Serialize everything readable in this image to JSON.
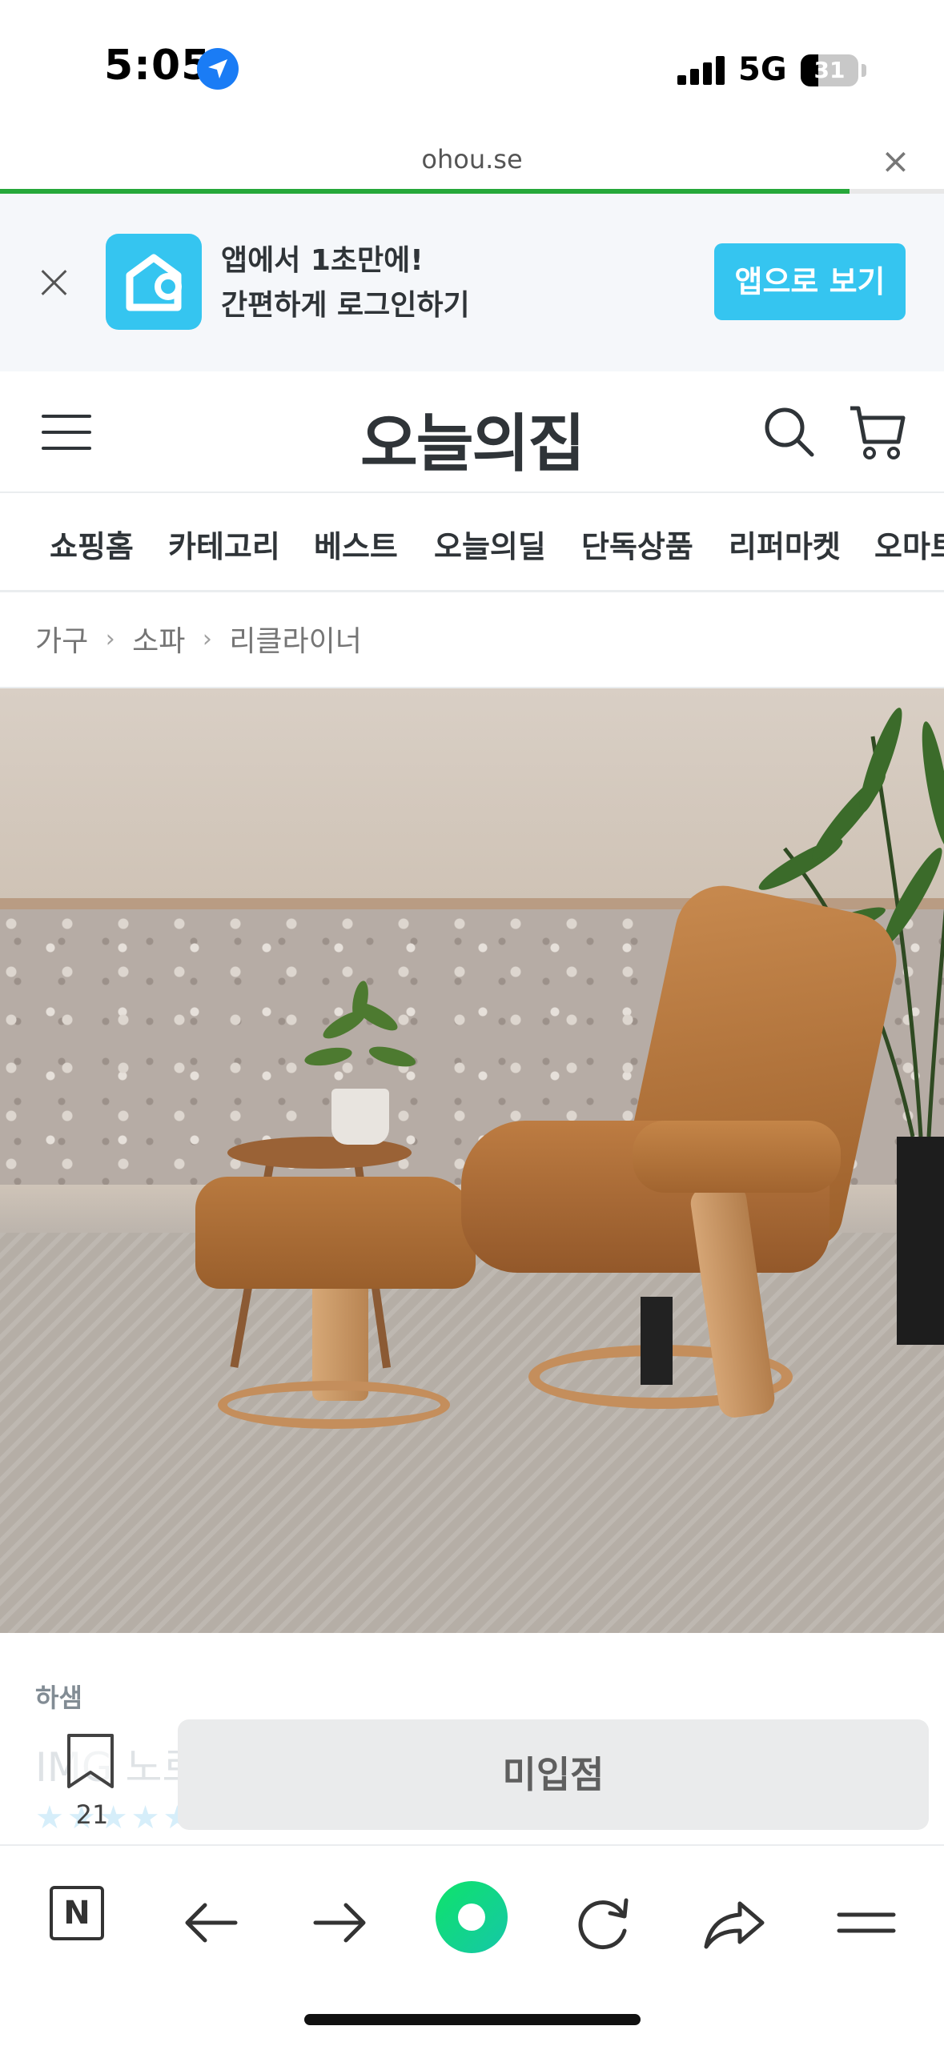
{
  "status_bar": {
    "time": "5:05",
    "network": "5G",
    "battery": "31",
    "battery_level": 0.31
  },
  "browser": {
    "url": "ohou.se",
    "close_label": "×",
    "load_progress": 0.9
  },
  "app_banner": {
    "line1": "앱에서 1초만에!",
    "line2": "간편하게 로그인하기",
    "button_label": "앱으로 보기",
    "accent_color": "#35c5f0"
  },
  "header": {
    "logo": "오늘의집"
  },
  "nav_tabs": [
    "쇼핑홈",
    "카테고리",
    "베스트",
    "오늘의딜",
    "단독상품",
    "리퍼마켓",
    "오마트"
  ],
  "breadcrumb": [
    "가구",
    "소파",
    "리클라이너"
  ],
  "product": {
    "brand": "하샘",
    "name": "IMG 노르",
    "rating_stars": "★★★★★",
    "bookmark_count": "21",
    "status_button": "미입점"
  },
  "toolbar": {
    "n_label": "N"
  },
  "icons": [
    "location-arrow-icon",
    "signal-icon",
    "battery-icon",
    "close-icon",
    "ohou-app-icon",
    "menu-icon",
    "search-icon",
    "cart-icon",
    "chevron-right-icon",
    "bookmark-icon",
    "naver-n-icon",
    "back-arrow-icon",
    "forward-arrow-icon",
    "green-dot-icon",
    "reload-icon",
    "share-icon",
    "hamburger-icon"
  ]
}
